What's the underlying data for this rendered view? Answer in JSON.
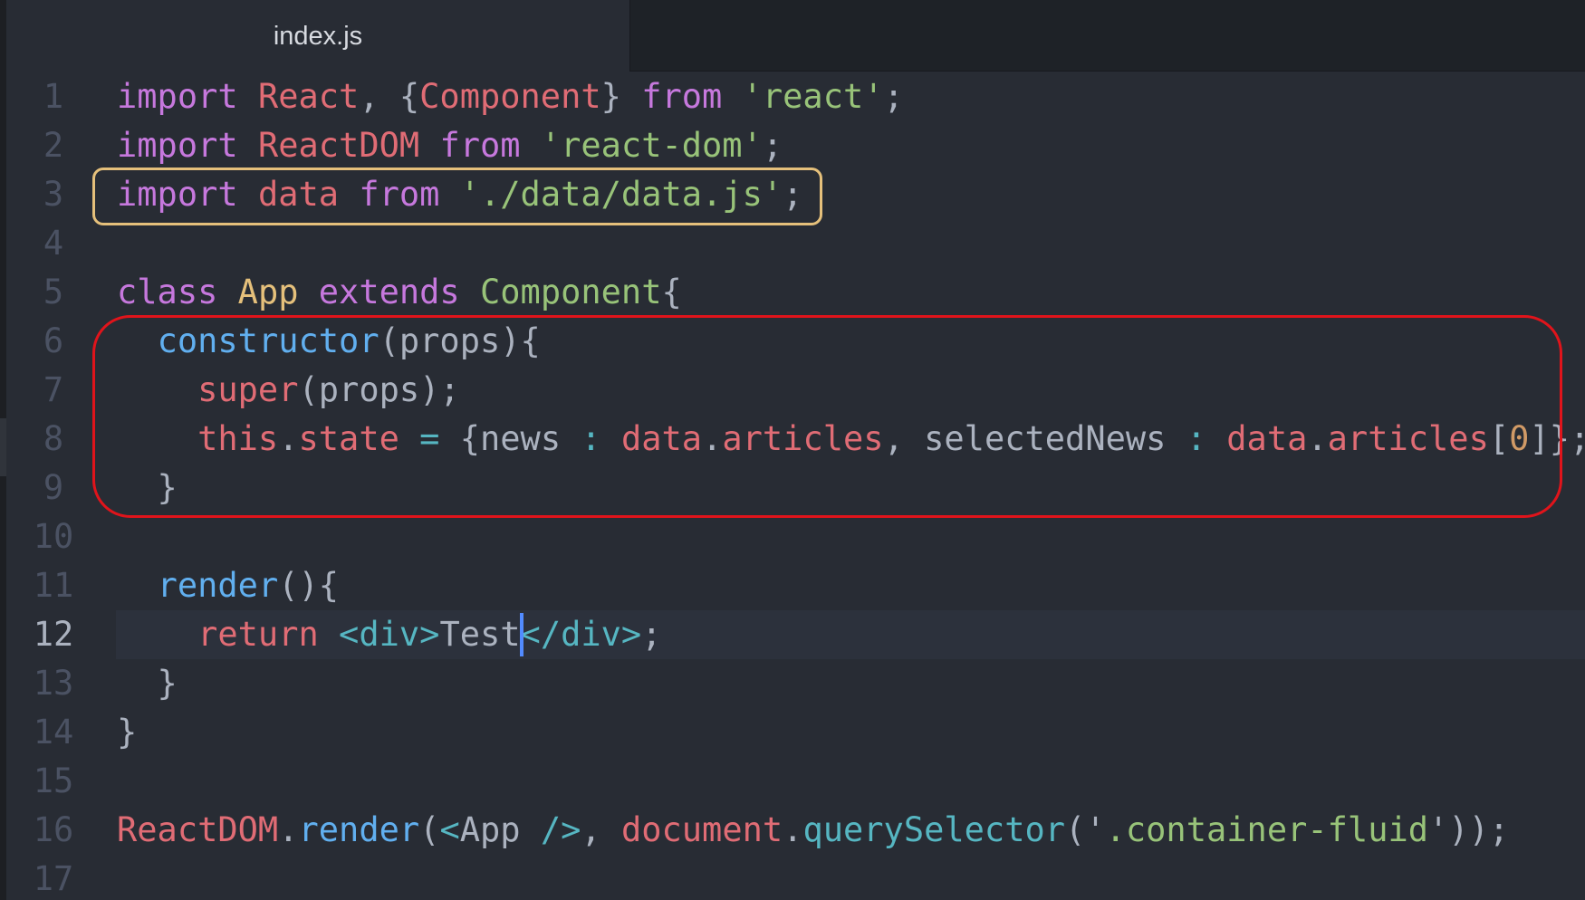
{
  "tab": {
    "title": "index.js"
  },
  "colors": {
    "keyword": "#c678dd",
    "variable": "#e06c75",
    "string": "#98c379",
    "class_name": "#e5c07b",
    "function": "#61afef",
    "operator": "#56b6c2",
    "plain": "#abb2bf",
    "number": "#d19a66",
    "highlight_yellow": "#e5c07b",
    "highlight_red": "#e0141b",
    "caret": "#528bff"
  },
  "editor": {
    "active_line": 12,
    "lines": [
      {
        "num": "1",
        "tokens": [
          [
            "import",
            "keyword"
          ],
          [
            " ",
            "plain"
          ],
          [
            "React",
            "variable"
          ],
          [
            ", {",
            "plain"
          ],
          [
            "Component",
            "variable"
          ],
          [
            "} ",
            "plain"
          ],
          [
            "from",
            "keyword"
          ],
          [
            " ",
            "plain"
          ],
          [
            "'react'",
            "string"
          ],
          [
            ";",
            "plain"
          ]
        ]
      },
      {
        "num": "2",
        "tokens": [
          [
            "import",
            "keyword"
          ],
          [
            " ",
            "plain"
          ],
          [
            "ReactDOM",
            "variable"
          ],
          [
            " ",
            "plain"
          ],
          [
            "from",
            "keyword"
          ],
          [
            " ",
            "plain"
          ],
          [
            "'react-dom'",
            "string"
          ],
          [
            ";",
            "plain"
          ]
        ]
      },
      {
        "num": "3",
        "tokens": [
          [
            "import",
            "keyword"
          ],
          [
            " ",
            "plain"
          ],
          [
            "data",
            "variable"
          ],
          [
            " ",
            "plain"
          ],
          [
            "from",
            "keyword"
          ],
          [
            " ",
            "plain"
          ],
          [
            "'./data/data.js'",
            "string"
          ],
          [
            ";",
            "plain"
          ]
        ]
      },
      {
        "num": "4",
        "tokens": []
      },
      {
        "num": "5",
        "tokens": [
          [
            "class",
            "keyword"
          ],
          [
            " ",
            "plain"
          ],
          [
            "App",
            "class_name"
          ],
          [
            " ",
            "plain"
          ],
          [
            "extends",
            "keyword"
          ],
          [
            " ",
            "plain"
          ],
          [
            "Component",
            "string"
          ],
          [
            "{",
            "plain"
          ]
        ]
      },
      {
        "num": "6",
        "tokens": [
          [
            "  ",
            "plain"
          ],
          [
            "constructor",
            "function"
          ],
          [
            "(props){",
            "plain"
          ]
        ]
      },
      {
        "num": "7",
        "tokens": [
          [
            "    ",
            "plain"
          ],
          [
            "super",
            "variable"
          ],
          [
            "(props);",
            "plain"
          ]
        ]
      },
      {
        "num": "8",
        "tokens": [
          [
            "    ",
            "plain"
          ],
          [
            "this",
            "variable"
          ],
          [
            ".",
            "plain"
          ],
          [
            "state",
            "variable"
          ],
          [
            " ",
            "plain"
          ],
          [
            "=",
            "operator"
          ],
          [
            " {news ",
            "plain"
          ],
          [
            ":",
            "operator"
          ],
          [
            " ",
            "plain"
          ],
          [
            "data",
            "variable"
          ],
          [
            ".",
            "plain"
          ],
          [
            "articles",
            "variable"
          ],
          [
            ", selectedNews ",
            "plain"
          ],
          [
            ":",
            "operator"
          ],
          [
            " ",
            "plain"
          ],
          [
            "data",
            "variable"
          ],
          [
            ".",
            "plain"
          ],
          [
            "articles",
            "variable"
          ],
          [
            "[",
            "plain"
          ],
          [
            "0",
            "number"
          ],
          [
            "]};",
            "plain"
          ]
        ]
      },
      {
        "num": "9",
        "tokens": [
          [
            "  }",
            "plain"
          ]
        ]
      },
      {
        "num": "10",
        "tokens": []
      },
      {
        "num": "11",
        "tokens": [
          [
            "  ",
            "plain"
          ],
          [
            "render",
            "function"
          ],
          [
            "(){",
            "plain"
          ]
        ]
      },
      {
        "num": "12",
        "tokens": [
          [
            "    ",
            "plain"
          ],
          [
            "return",
            "variable"
          ],
          [
            " ",
            "plain"
          ],
          [
            "<div>",
            "operator"
          ],
          [
            "Test",
            "plain"
          ],
          [
            "</div>",
            "operator"
          ],
          [
            ";",
            "plain"
          ]
        ]
      },
      {
        "num": "13",
        "tokens": [
          [
            "  }",
            "plain"
          ]
        ]
      },
      {
        "num": "14",
        "tokens": [
          [
            "}",
            "plain"
          ]
        ]
      },
      {
        "num": "15",
        "tokens": []
      },
      {
        "num": "16",
        "tokens": [
          [
            "ReactDOM",
            "variable"
          ],
          [
            ".",
            "plain"
          ],
          [
            "render",
            "function"
          ],
          [
            "(",
            "plain"
          ],
          [
            "<",
            "operator"
          ],
          [
            "App ",
            "plain"
          ],
          [
            "/>",
            "operator"
          ],
          [
            ", ",
            "plain"
          ],
          [
            "document",
            "variable"
          ],
          [
            ".",
            "plain"
          ],
          [
            "querySelector",
            "operator"
          ],
          [
            "('",
            "plain"
          ],
          [
            ".container-fluid",
            "string"
          ],
          [
            "'));",
            "plain"
          ]
        ]
      },
      {
        "num": "17",
        "tokens": []
      }
    ]
  }
}
